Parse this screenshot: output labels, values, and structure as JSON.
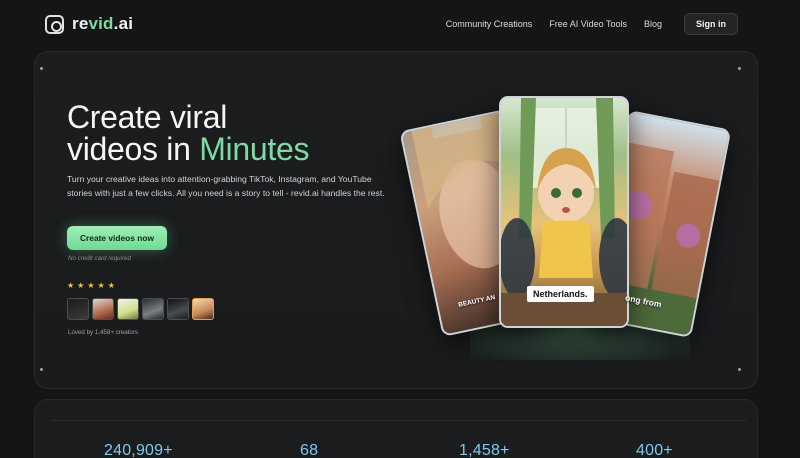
{
  "nav": {
    "logo_prefix": "re",
    "logo_accent": "vid",
    "logo_suffix": ".ai",
    "links": [
      "Community Creations",
      "Free AI Video Tools",
      "Blog"
    ],
    "signin_label": "Sign in"
  },
  "hero": {
    "headline_line1": "Create viral",
    "headline_line2_plain": "videos in ",
    "headline_line2_accent": "Minutes",
    "subtext": "Turn your creative ideas into attention-grabbing TikTok, Instagram, and YouTube stories with just a few clicks. All you need is a story to tell - revid.ai handles the rest.",
    "cta_label": "Create videos now",
    "no_credit_card": "No credit card required",
    "rating_stars": 5,
    "avatar_count": 6,
    "loved_by": "Loved by 1,458+ creators"
  },
  "cards": {
    "left_caption": "BEAUTY AN",
    "center_caption": "Netherlands.",
    "right_caption": "ong from"
  },
  "stats": [
    "240,909+",
    "68",
    "1,458+",
    "400+"
  ],
  "colors": {
    "background": "#141516",
    "accent_green": "#7fd9a4",
    "cta_green": "#8fe8ab",
    "stat_blue": "#7fc8f0",
    "star_gold": "#f4c542"
  }
}
